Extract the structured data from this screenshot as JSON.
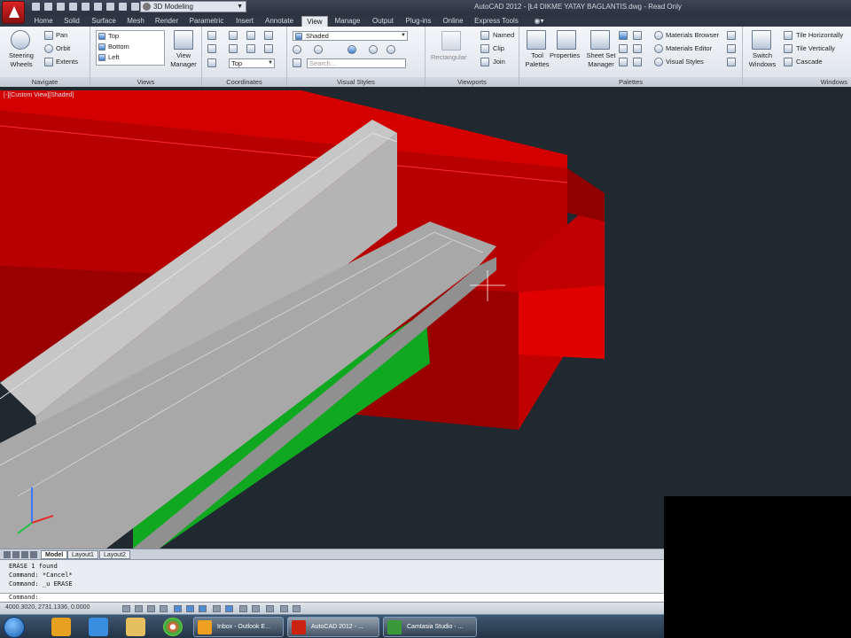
{
  "window": {
    "title": "AutoCAD 2012 - [Ł4 DIKME YATAY BAGLANTIS.dwg - Read Only",
    "workspace": "3D Modeling"
  },
  "tabs": [
    {
      "label": "Home",
      "active": false
    },
    {
      "label": "Solid",
      "active": false
    },
    {
      "label": "Surface",
      "active": false
    },
    {
      "label": "Mesh",
      "active": false
    },
    {
      "label": "Render",
      "active": false
    },
    {
      "label": "Parametric",
      "active": false
    },
    {
      "label": "Insert",
      "active": false
    },
    {
      "label": "Annotate",
      "active": false
    },
    {
      "label": "View",
      "active": true
    },
    {
      "label": "Manage",
      "active": false
    },
    {
      "label": "Output",
      "active": false
    },
    {
      "label": "Plug-ins",
      "active": false
    },
    {
      "label": "Online",
      "active": false
    },
    {
      "label": "Express Tools",
      "active": false
    }
  ],
  "ribbon": {
    "navigate": {
      "title": "Navigate",
      "steering_wheels": "Steering Wheels",
      "pan": "Pan",
      "orbit": "Orbit",
      "extents": "Extents"
    },
    "views": {
      "title": "Views",
      "items": [
        "Top",
        "Bottom",
        "Left"
      ],
      "view_manager": "View Manager"
    },
    "coordinates": {
      "title": "Coordinates",
      "ucs_combo": "Top"
    },
    "visual_styles": {
      "title": "Visual Styles",
      "style_combo": "Shaded",
      "search_placeholder": "Search..."
    },
    "viewports": {
      "title": "Viewports",
      "rectangular": "Rectangular",
      "named": "Named",
      "clip": "Clip",
      "join": "Join"
    },
    "palettes": {
      "title": "Palettes",
      "tool_palettes": "Tool Palettes",
      "properties": "Properties",
      "sheet_set_manager": "Sheet Set Manager",
      "materials_browser": "Materials Browser",
      "materials_editor": "Materials Editor",
      "visual_styles": "Visual Styles"
    },
    "windows": {
      "title": "Windows",
      "switch_windows": "Switch Windows",
      "tile_horizontally": "Tile Horizontally",
      "tile_vertically": "Tile Vertically",
      "cascade": "Cascade"
    }
  },
  "viewport": {
    "label": "[-][Custom View][Shaded]"
  },
  "layout_tabs": [
    {
      "label": "Model",
      "active": true
    },
    {
      "label": "Layout1",
      "active": false
    },
    {
      "label": "Layout2",
      "active": false
    }
  ],
  "command": {
    "history": [
      "ERASE 1 found",
      "Command: *Cancel*",
      "Command: _u ERASE"
    ],
    "prompt": "Command:"
  },
  "status": {
    "coordinates": "4000.3020, 2731.1336, 0.0000"
  },
  "taskbar": {
    "tasks": [
      {
        "label": "Inbox - Outlook E...",
        "active": false
      },
      {
        "label": "AutoCAD 2012 - ...",
        "active": true
      },
      {
        "label": "Camtasia Studio - ...",
        "active": false
      }
    ]
  },
  "colors": {
    "model_red": "#c80000",
    "model_grey": "#b4b4b4",
    "model_green": "#10a820",
    "background": "#202830"
  }
}
